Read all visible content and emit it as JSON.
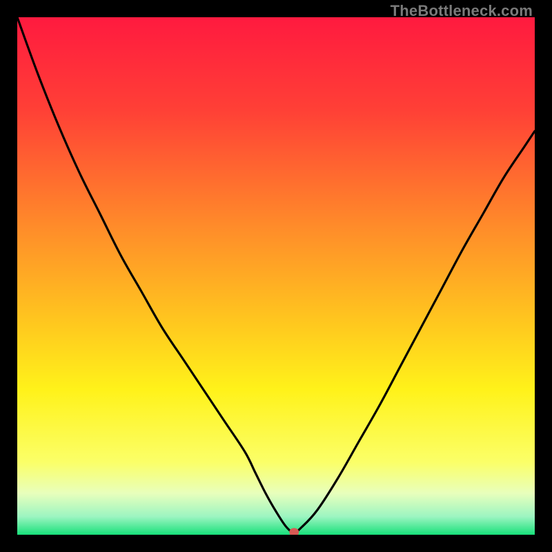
{
  "watermark": {
    "text": "TheBottleneck.com"
  },
  "chart_data": {
    "type": "line",
    "title": "",
    "xlabel": "",
    "ylabel": "",
    "xlim": [
      0,
      100
    ],
    "ylim": [
      0,
      100
    ],
    "series": [
      {
        "name": "curve",
        "x": [
          0,
          4,
          8,
          12,
          16,
          20,
          24,
          28,
          32,
          36,
          40,
          44,
          46,
          48,
          50,
          52,
          53.5,
          55,
          58,
          62,
          66,
          70,
          74,
          78,
          82,
          86,
          90,
          94,
          98,
          100
        ],
        "y": [
          100,
          89,
          79,
          70,
          62,
          54,
          47,
          40,
          34,
          28,
          22,
          16,
          12,
          8,
          4.5,
          1.5,
          0.5,
          1.5,
          4.8,
          11,
          18,
          25,
          32.5,
          40,
          47.5,
          55,
          62,
          69,
          75,
          78
        ]
      }
    ],
    "marker": {
      "x": 53.5,
      "y": 0.5,
      "color": "#d85a54"
    },
    "background_gradient": {
      "stops": [
        {
          "offset": 0,
          "color": "#ff1a3f"
        },
        {
          "offset": 0.18,
          "color": "#ff4036"
        },
        {
          "offset": 0.4,
          "color": "#ff8a2a"
        },
        {
          "offset": 0.58,
          "color": "#ffc41f"
        },
        {
          "offset": 0.72,
          "color": "#fff21a"
        },
        {
          "offset": 0.86,
          "color": "#fbff68"
        },
        {
          "offset": 0.92,
          "color": "#e8ffbc"
        },
        {
          "offset": 0.965,
          "color": "#9cf5c1"
        },
        {
          "offset": 1.0,
          "color": "#18e07a"
        }
      ]
    }
  }
}
